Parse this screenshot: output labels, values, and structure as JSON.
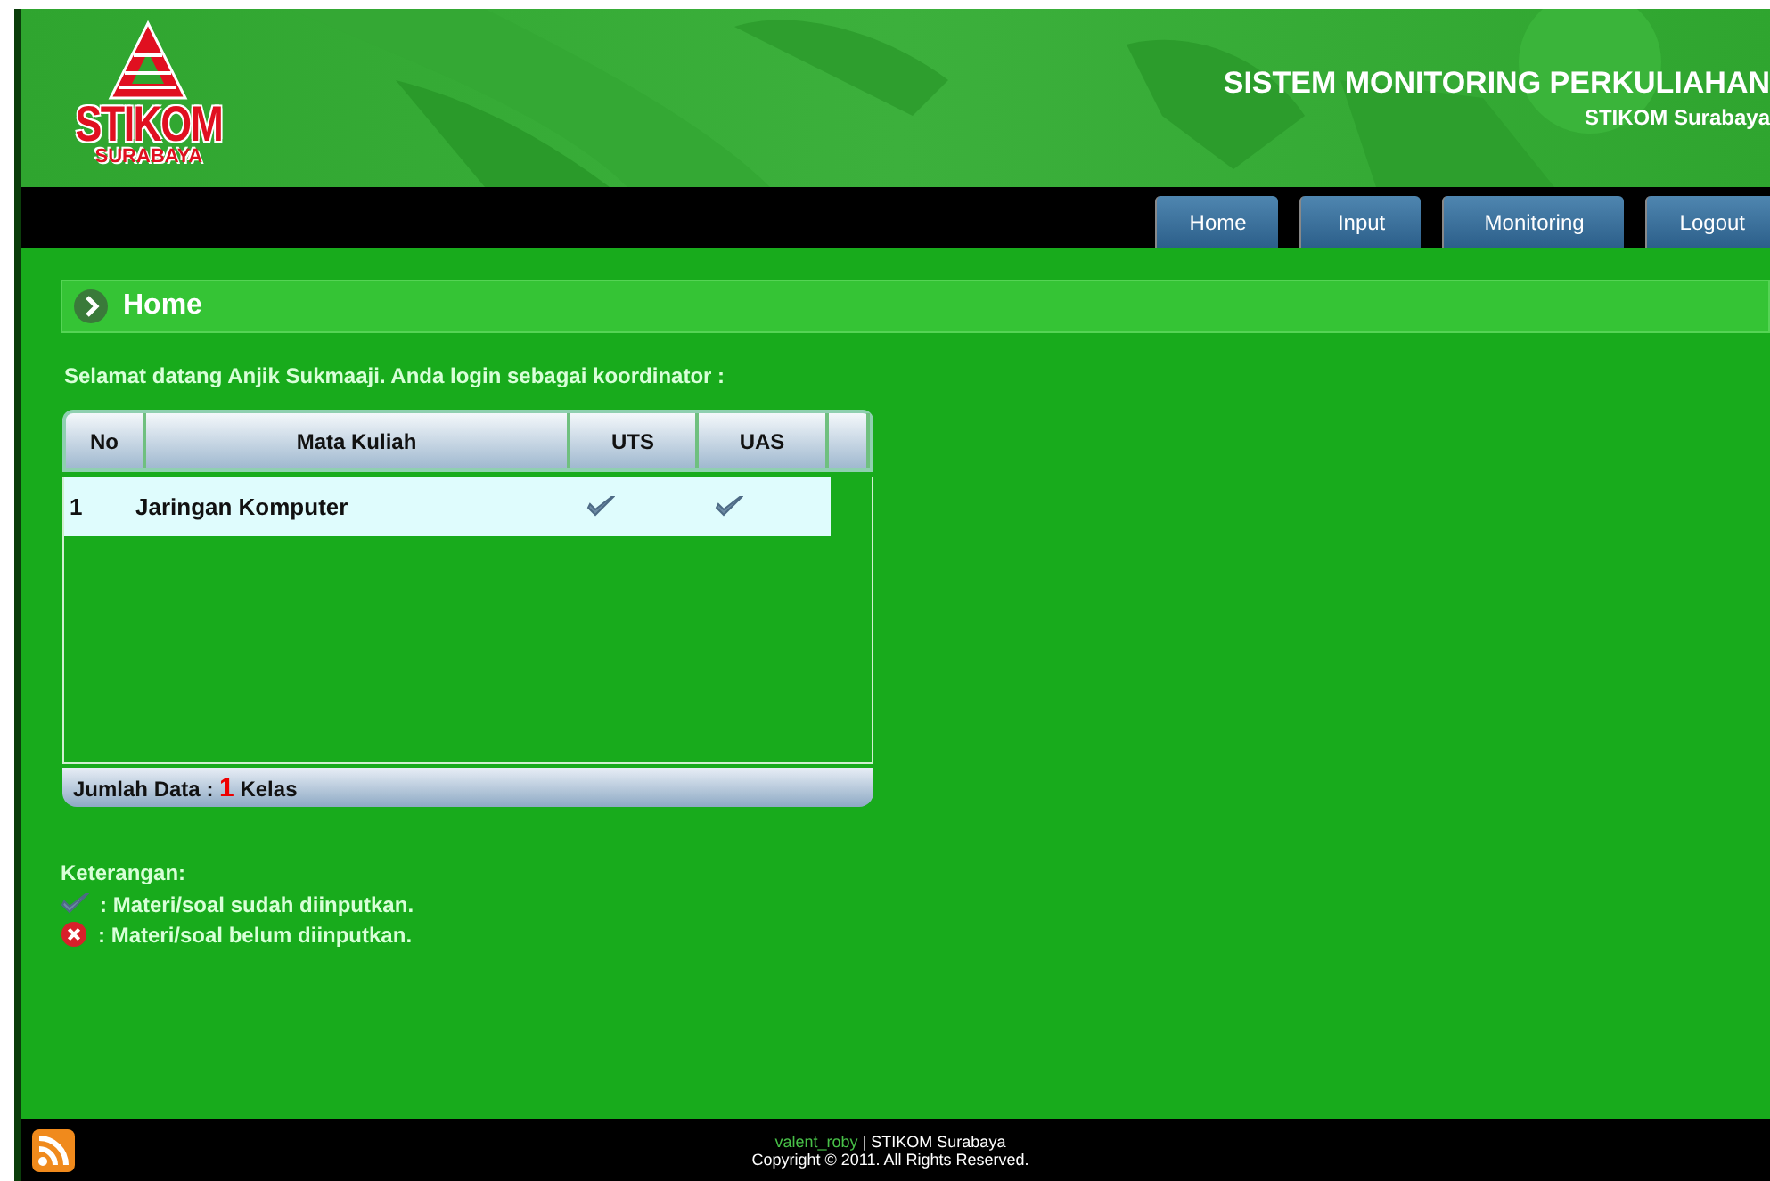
{
  "header": {
    "logo": {
      "name": "STIKOM",
      "city": "SURABAYA"
    },
    "title": "SISTEM MONITORING PERKULIAHAN",
    "subtitle": "STIKOM Surabaya"
  },
  "nav": [
    {
      "label": "Home"
    },
    {
      "label": "Input"
    },
    {
      "label": "Monitoring"
    },
    {
      "label": "Logout"
    }
  ],
  "section_title": "Home",
  "welcome": "Selamat datang Anjik Sukmaaji. Anda login sebagai koordinator :",
  "table": {
    "columns": [
      "No",
      "Mata Kuliah",
      "UTS",
      "UAS"
    ],
    "rows": [
      {
        "no": "1",
        "course": "Jaringan Komputer",
        "uts_done": true,
        "uas_done": true
      }
    ],
    "summary": {
      "prefix": "Jumlah Data :",
      "count": "1",
      "suffix": "Kelas"
    }
  },
  "legend": {
    "title": "Keterangan:",
    "items": [
      {
        "kind": "check",
        "text": ": Materi/soal sudah diinputkan."
      },
      {
        "kind": "cross",
        "text": ": Materi/soal belum diinputkan."
      }
    ]
  },
  "footer": {
    "author": "valent_roby",
    "org": "| STIKOM Surabaya",
    "copyright": "Copyright © 2011. All Rights Reserved."
  }
}
